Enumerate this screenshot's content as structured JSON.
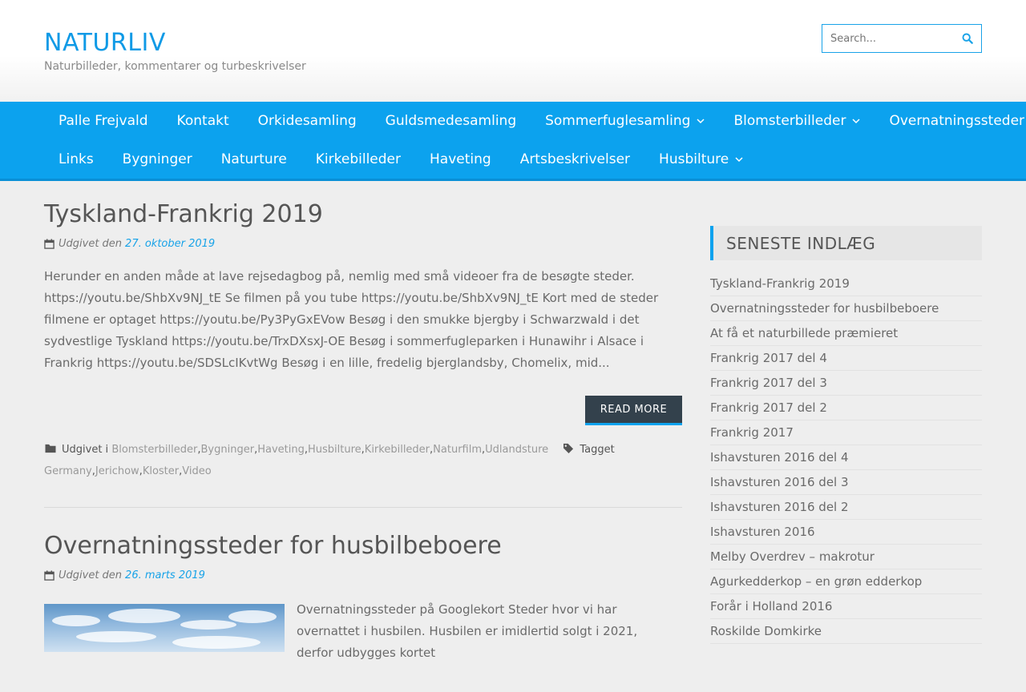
{
  "site": {
    "title": "NATURLIV",
    "tagline": "Naturbilleder, kommentarer og turbeskrivelser"
  },
  "search": {
    "placeholder": "Search..."
  },
  "nav": {
    "row1": [
      {
        "label": "Palle Frejvald",
        "dropdown": false
      },
      {
        "label": "Kontakt",
        "dropdown": false
      },
      {
        "label": "Orkidesamling",
        "dropdown": false
      },
      {
        "label": "Guldsmedesamling",
        "dropdown": false
      },
      {
        "label": "Sommerfuglesamling",
        "dropdown": true
      },
      {
        "label": "Blomsterbilleder",
        "dropdown": true
      },
      {
        "label": "Overnatningssteder",
        "dropdown": false
      }
    ],
    "row2": [
      {
        "label": "Links",
        "dropdown": false
      },
      {
        "label": "Bygninger",
        "dropdown": false
      },
      {
        "label": "Naturture",
        "dropdown": false
      },
      {
        "label": "Kirkebilleder",
        "dropdown": false
      },
      {
        "label": "Haveting",
        "dropdown": false
      },
      {
        "label": "Artsbeskrivelser",
        "dropdown": false
      },
      {
        "label": "Husbilture",
        "dropdown": true
      }
    ]
  },
  "posts": [
    {
      "title": "Tyskland-Frankrig 2019",
      "published_prefix": "Udgivet den",
      "date": "27. oktober 2019",
      "excerpt": "Herunder en anden måde at lave rejsedagbog på, nemlig med små videoer fra de besøgte steder. https://youtu.be/ShbXv9NJ_tE Se filmen på you tube https://youtu.be/ShbXv9NJ_tE Kort med de steder filmene er optaget https://youtu.be/Py3PyGxEVow Besøg i den smukke bjergby i Schwarzwald i det sydvestlige Tyskland https://youtu.be/TrxDXsxJ-OE Besøg i sommerfugleparken i Hunawihr i Alsace i Frankrig https://youtu.be/SDSLcIKvtWg Besøg i en lille, fredelig bjerglandsby, Chomelix, mid...",
      "read_more": "READ MORE",
      "cat_prefix": "Udgivet i",
      "categories": [
        "Blomsterbilleder",
        "Bygninger",
        "Haveting",
        "Husbilture",
        "Kirkebilleder",
        "Naturfilm",
        "Udlandsture"
      ],
      "tag_prefix": "Tagget",
      "tags": [
        "Germany",
        "Jerichow",
        "Kloster",
        "Video"
      ]
    },
    {
      "title": "Overnatningssteder for husbilbeboere",
      "published_prefix": "Udgivet den",
      "date": "26. marts 2019",
      "excerpt": "Overnatningssteder på Googlekort Steder hvor vi har overnattet i husbilen. Husbilen er imidlertid solgt i 2021, derfor udbygges kortet"
    }
  ],
  "sidebar": {
    "title": "SENESTE INDLÆG",
    "recent": [
      "Tyskland-Frankrig 2019",
      "Overnatningssteder for husbilbeboere",
      "At få et naturbillede præmieret",
      "Frankrig 2017 del 4",
      "Frankrig 2017 del 3",
      "Frankrig 2017 del 2",
      "Frankrig 2017",
      "Ishavsturen 2016 del 4",
      "Ishavsturen 2016 del 3",
      "Ishavsturen 2016 del 2",
      "Ishavsturen 2016",
      "Melby Overdrev – makrotur",
      "Agurkedderkop – en grøn edderkop",
      "Forår i Holland 2016",
      "Roskilde Domkirke"
    ]
  },
  "colors": {
    "accent": "#0ca2ee",
    "button": "#33414c"
  }
}
